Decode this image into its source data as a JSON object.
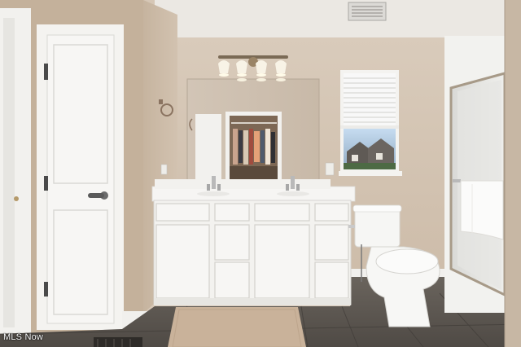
{
  "photo": {
    "subject": "bathroom",
    "colors": {
      "wall": "#d7c8b7",
      "ceiling": "#ece9e4",
      "trim": "#f4f3f0",
      "floor": "#5d5853",
      "vanity": "#f3f2ef",
      "countertop": "#f6f5f3",
      "mirror_glass": "#cfc3b6",
      "chrome": "#b9b9b9",
      "rug": "#c9b29a",
      "window_sky": "#b9d2ea"
    }
  },
  "watermark": {
    "text": "MLS Now"
  }
}
